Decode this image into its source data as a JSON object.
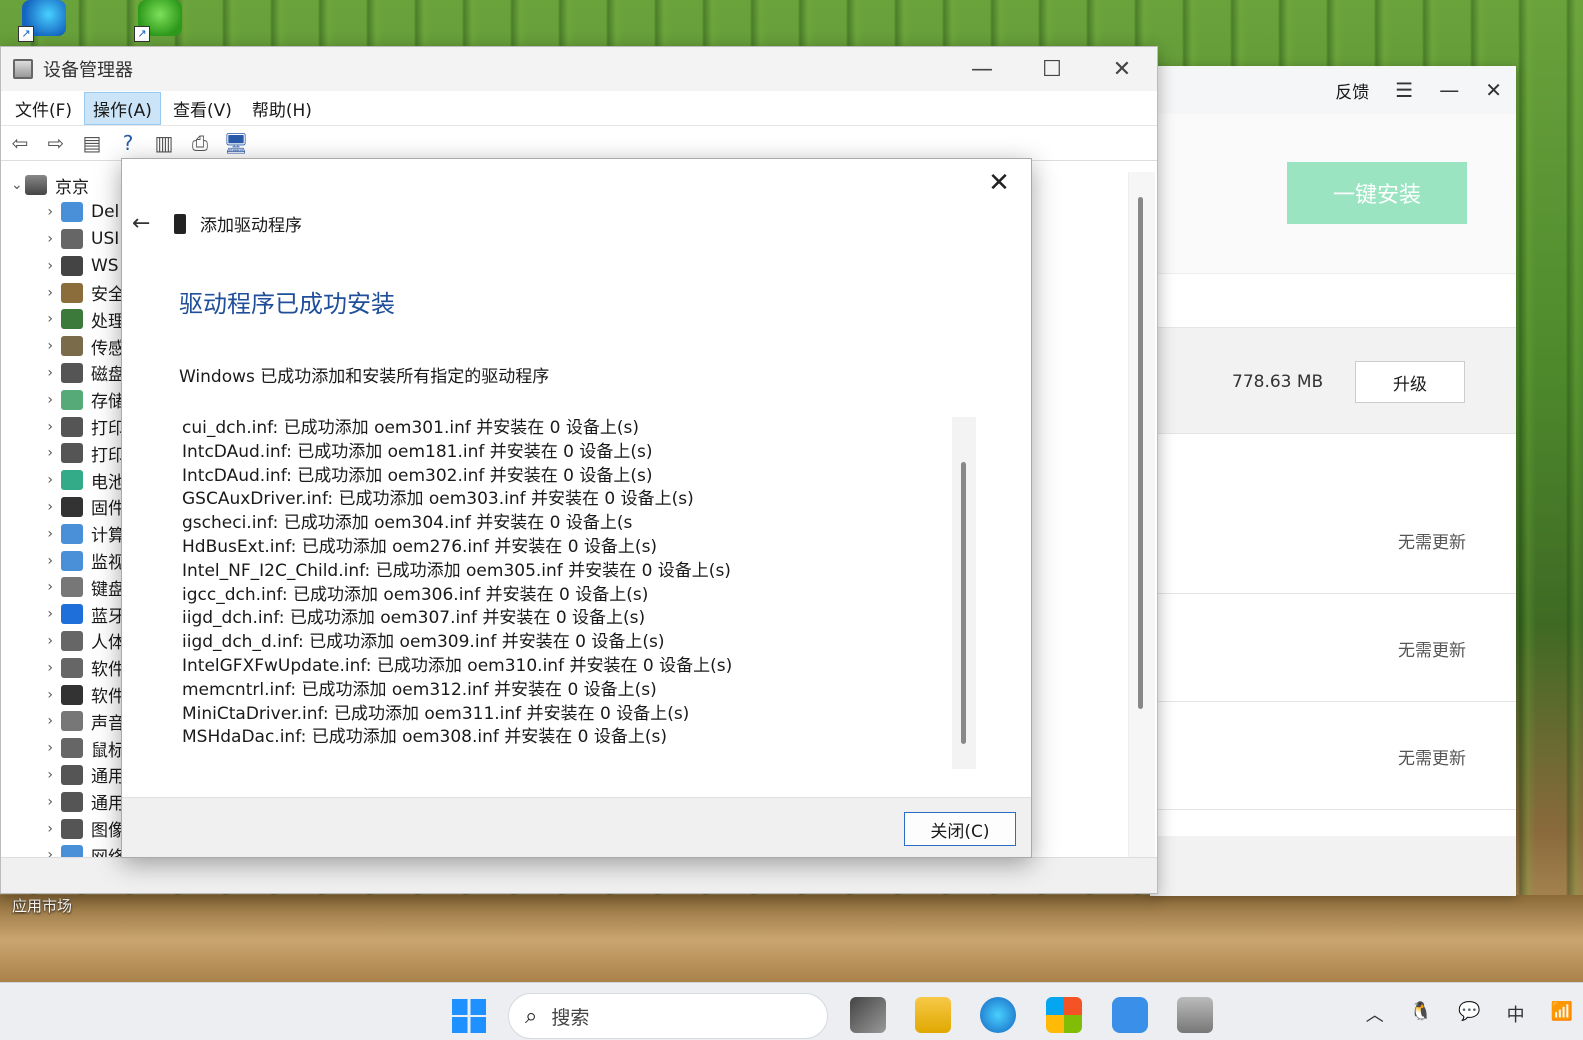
{
  "desktop": {
    "label_bottom": "应用市场"
  },
  "app_window": {
    "feedback": "反馈",
    "install_button": "一键安装",
    "size": "778.63 MB",
    "upgrade": "升级",
    "no_update": [
      "无需更新",
      "无需更新",
      "无需更新"
    ]
  },
  "device_manager": {
    "title": "设备管理器",
    "menu": [
      "文件(F)",
      "操作(A)",
      "查看(V)",
      "帮助(H)"
    ],
    "root": "京京",
    "items": [
      "Del",
      "USI",
      "WS",
      "安全",
      "处理",
      "传感",
      "磁盘",
      "存储",
      "打印",
      "打印",
      "电池",
      "固件",
      "计算",
      "监视",
      "键盘",
      "蓝牙",
      "人体",
      "软件",
      "软件",
      "声音",
      "鼠标",
      "通用",
      "通用",
      "图像",
      "网络"
    ]
  },
  "dialog": {
    "header": "添加驱动程序",
    "heading": "驱动程序已成功安装",
    "description": "Windows 已成功添加和安装所有指定的驱动程序",
    "lines": [
      "cui_dch.inf: 已成功添加 oem301.inf 并安装在 0 设备上(s)",
      "IntcDAud.inf: 已成功添加 oem181.inf 并安装在 0 设备上(s)",
      "IntcDAud.inf: 已成功添加 oem302.inf 并安装在 0 设备上(s)",
      "GSCAuxDriver.inf: 已成功添加 oem303.inf 并安装在 0 设备上(s)",
      "gscheci.inf: 已成功添加 oem304.inf 并安装在 0 设备上(s",
      "HdBusExt.inf: 已成功添加 oem276.inf 并安装在 0 设备上(s)",
      "Intel_NF_I2C_Child.inf: 已成功添加 oem305.inf 并安装在 0 设备上(s)",
      "igcc_dch.inf: 已成功添加 oem306.inf 并安装在 0 设备上(s)",
      "iigd_dch.inf: 已成功添加 oem307.inf 并安装在 0 设备上(s)",
      "iigd_dch_d.inf: 已成功添加 oem309.inf 并安装在 0 设备上(s)",
      "IntelGFXFwUpdate.inf: 已成功添加 oem310.inf 并安装在 0 设备上(s)",
      "memcntrl.inf: 已成功添加 oem312.inf 并安装在 0 设备上(s)",
      "MiniCtaDriver.inf: 已成功添加 oem311.inf 并安装在 0 设备上(s)",
      "MSHdaDac.inf: 已成功添加 oem308.inf 并安装在 0 设备上(s)"
    ],
    "close_button": "关闭(C)"
  },
  "taskbar": {
    "search_placeholder": "搜索",
    "tray_ime": "中"
  }
}
